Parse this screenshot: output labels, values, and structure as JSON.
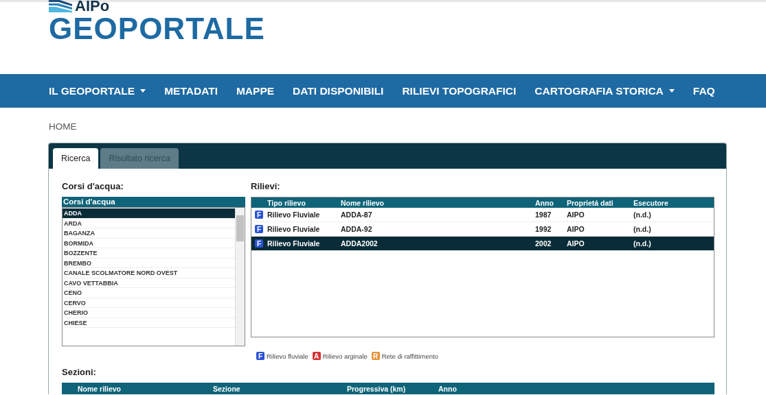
{
  "header": {
    "brand": "AIPo",
    "title": "GEOPORTALE"
  },
  "nav": [
    {
      "label": "IL GEOPORTALE",
      "dropdown": true
    },
    {
      "label": "METADATI",
      "dropdown": false
    },
    {
      "label": "MAPPE",
      "dropdown": false
    },
    {
      "label": "DATI DISPONIBILI",
      "dropdown": false
    },
    {
      "label": "RILIEVI TOPOGRAFICI",
      "dropdown": false
    },
    {
      "label": "CARTOGRAFIA STORICA",
      "dropdown": true
    },
    {
      "label": "FAQ",
      "dropdown": false
    }
  ],
  "breadcrumb": "HOME",
  "tabs": [
    {
      "label": "Ricerca",
      "selected": true
    },
    {
      "label": "Risultato ricerca",
      "selected": false
    }
  ],
  "corsi": {
    "title": "Corsi d'acqua:",
    "header": "Corsi d'acqua",
    "items": [
      {
        "label": "ADDA",
        "selected": true
      },
      {
        "label": "ARDA",
        "selected": false
      },
      {
        "label": "BAGANZA",
        "selected": false
      },
      {
        "label": "BORMIDA",
        "selected": false
      },
      {
        "label": "BOZZENTE",
        "selected": false
      },
      {
        "label": "BREMBO",
        "selected": false
      },
      {
        "label": "CANALE SCOLMATORE NORD OVEST",
        "selected": false
      },
      {
        "label": "CAVO VETTABBIA",
        "selected": false
      },
      {
        "label": "CENO",
        "selected": false
      },
      {
        "label": "CERVO",
        "selected": false
      },
      {
        "label": "CHERIO",
        "selected": false
      },
      {
        "label": "CHIESE",
        "selected": false
      }
    ]
  },
  "rilievi": {
    "title": "Rilievi:",
    "columns": [
      "Tipo rilievo",
      "Nome rilievo",
      "Anno",
      "Proprietá dati",
      "Esecutore"
    ],
    "rows": [
      {
        "badge": "F",
        "color": "#2a52d6",
        "cells": [
          "Rilievo Fluviale",
          "ADDA-87",
          "1987",
          "AIPO",
          "(n.d.)"
        ],
        "selected": false
      },
      {
        "badge": "F",
        "color": "#2a52d6",
        "cells": [
          "Rilievo Fluviale",
          "ADDA-92",
          "1992",
          "AIPO",
          "(n.d.)"
        ],
        "selected": false
      },
      {
        "badge": "F",
        "color": "#2a52d6",
        "cells": [
          "Rilievo Fluviale",
          "ADDA2002",
          "2002",
          "AIPO",
          "(n.d.)"
        ],
        "selected": true
      }
    ]
  },
  "legend": [
    {
      "badge": "F",
      "color": "#2a52d6",
      "label": "Rilievo fluviale"
    },
    {
      "badge": "A",
      "color": "#d63333",
      "label": "Rilievo arginale"
    },
    {
      "badge": "R",
      "color": "#e8923a",
      "label": "Rete di raffittimento"
    }
  ],
  "sezioni": {
    "title": "Sezioni:",
    "columns": [
      "Nome rilievo",
      "Sezione",
      "Progressiva (km)",
      "Anno"
    ]
  }
}
